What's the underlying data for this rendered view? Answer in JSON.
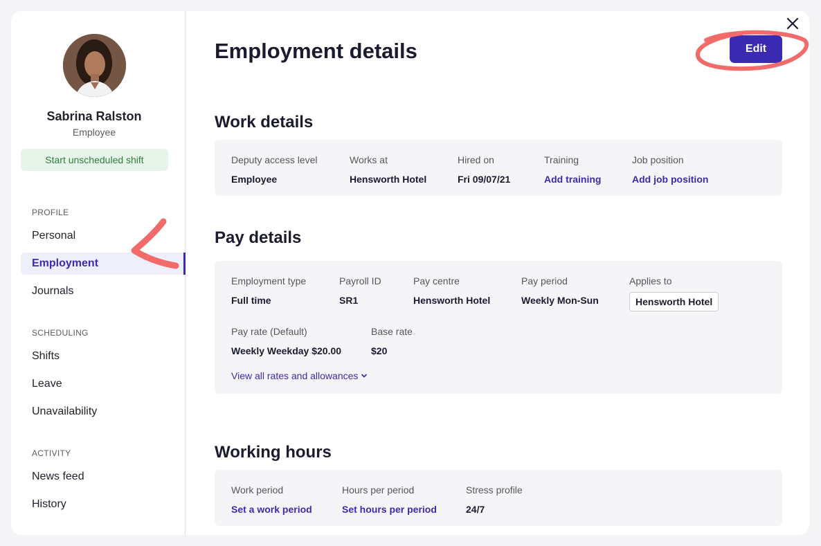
{
  "profile": {
    "name": "Sabrina Ralston",
    "role": "Employee",
    "start_shift_label": "Start unscheduled shift"
  },
  "nav": {
    "sections": [
      {
        "label": "PROFILE",
        "items": [
          "Personal",
          "Employment",
          "Journals"
        ]
      },
      {
        "label": "SCHEDULING",
        "items": [
          "Shifts",
          "Leave",
          "Unavailability"
        ]
      },
      {
        "label": "ACTIVITY",
        "items": [
          "News feed",
          "History"
        ]
      }
    ],
    "active_item": "Employment"
  },
  "header": {
    "title": "Employment details",
    "edit_label": "Edit",
    "close_icon": "close-icon"
  },
  "work_details": {
    "heading": "Work details",
    "fields": [
      {
        "label": "Deputy access level",
        "value": "Employee"
      },
      {
        "label": "Works at",
        "value": "Hensworth Hotel"
      },
      {
        "label": "Hired on",
        "value": "Fri 09/07/21"
      },
      {
        "label": "Training",
        "value": "Add training"
      },
      {
        "label": "Job position",
        "value": "Add job position"
      }
    ]
  },
  "pay_details": {
    "heading": "Pay details",
    "fields": [
      {
        "label": "Employment type",
        "value": "Full time"
      },
      {
        "label": "Payroll ID",
        "value": "SR1"
      },
      {
        "label": "Pay centre",
        "value": "Hensworth Hotel"
      },
      {
        "label": "Pay period",
        "value": "Weekly Mon-Sun"
      },
      {
        "label": "Applies to",
        "value": "Hensworth Hotel"
      },
      {
        "label": "Pay rate (Default)",
        "value": "Weekly Weekday $20.00"
      },
      {
        "label": "Base rate",
        "value": "$20"
      }
    ],
    "view_all_label": "View all rates and allowances"
  },
  "working_hours": {
    "heading": "Working hours",
    "fields": [
      {
        "label": "Work period",
        "value": "Set a work period"
      },
      {
        "label": "Hours per period",
        "value": "Set hours per period"
      },
      {
        "label": "Stress profile",
        "value": "24/7"
      }
    ]
  },
  "colors": {
    "accent": "#3b2bb3",
    "success_bg": "#e6f4e9",
    "success_text": "#2e7d3a",
    "annotation": "#f26b6b"
  }
}
